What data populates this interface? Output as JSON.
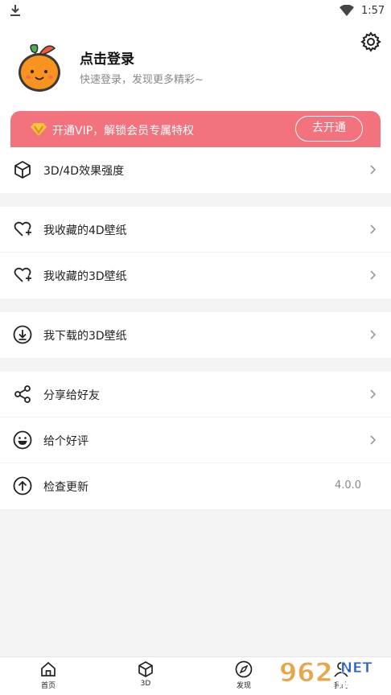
{
  "statusbar": {
    "time": "1:57"
  },
  "profile": {
    "login_title": "点击登录",
    "login_subtitle": "快速登录，发现更多精彩~"
  },
  "vip": {
    "text": "开通VIP，解锁会员专属特权",
    "button": "去开通",
    "color": "#f2737d"
  },
  "menu": {
    "effect": "3D/4D效果强度",
    "fav4d": "我收藏的4D壁纸",
    "fav3d": "我收藏的3D壁纸",
    "downloaded3d": "我下载的3D壁纸",
    "share": "分享给好友",
    "rate": "给个好评",
    "update": "检查更新",
    "version": "4.0.0"
  },
  "tabs": {
    "home": "首页",
    "d3": "3D",
    "discover": "发现",
    "mine": "我的"
  },
  "watermark": {
    "text": "962",
    "subtext": "乐游网",
    "net": "NET"
  }
}
